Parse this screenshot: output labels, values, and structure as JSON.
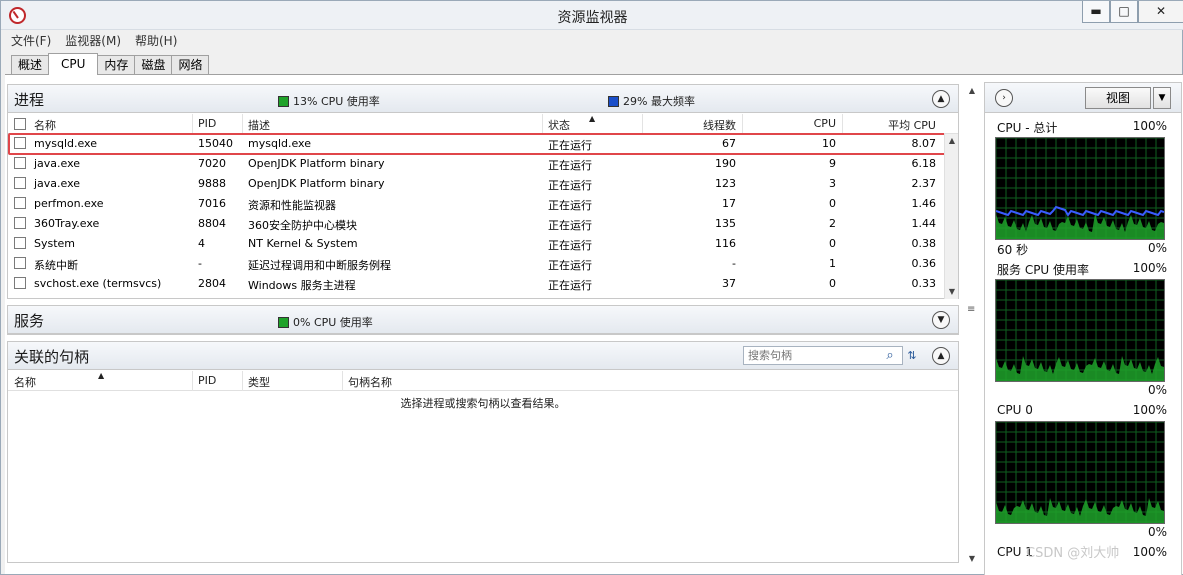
{
  "window": {
    "title": "资源监视器",
    "btn_min": "▬",
    "btn_max": "□",
    "btn_close": "✕"
  },
  "menu": [
    "文件(F)",
    "监视器(M)",
    "帮助(H)"
  ],
  "tabs": [
    "概述",
    "CPU",
    "内存",
    "磁盘",
    "网络"
  ],
  "active_tab": "CPU",
  "process_section": {
    "title": "进程",
    "legend1": "13% CPU 使用率",
    "legend2": "29% 最大频率",
    "legend1_color": "#1fa22a",
    "legend2_color": "#1a4ec9",
    "columns": [
      "名称",
      "PID",
      "描述",
      "状态",
      "线程数",
      "CPU",
      "平均 CPU"
    ],
    "rows": [
      {
        "name": "mysqld.exe",
        "pid": "15040",
        "desc": "mysqld.exe",
        "status": "正在运行",
        "threads": "67",
        "cpu": "10",
        "avg": "8.07",
        "highlight": true
      },
      {
        "name": "java.exe",
        "pid": "7020",
        "desc": "OpenJDK Platform binary",
        "status": "正在运行",
        "threads": "190",
        "cpu": "9",
        "avg": "6.18"
      },
      {
        "name": "java.exe",
        "pid": "9888",
        "desc": "OpenJDK Platform binary",
        "status": "正在运行",
        "threads": "123",
        "cpu": "3",
        "avg": "2.37"
      },
      {
        "name": "perfmon.exe",
        "pid": "7016",
        "desc": "资源和性能监视器",
        "status": "正在运行",
        "threads": "17",
        "cpu": "0",
        "avg": "1.46"
      },
      {
        "name": "360Tray.exe",
        "pid": "8804",
        "desc": "360安全防护中心模块",
        "status": "正在运行",
        "threads": "135",
        "cpu": "2",
        "avg": "1.44"
      },
      {
        "name": "System",
        "pid": "4",
        "desc": "NT Kernel & System",
        "status": "正在运行",
        "threads": "116",
        "cpu": "0",
        "avg": "0.38"
      },
      {
        "name": "系统中断",
        "pid": "-",
        "desc": "延迟过程调用和中断服务例程",
        "status": "正在运行",
        "threads": "-",
        "cpu": "1",
        "avg": "0.36"
      },
      {
        "name": "svchost.exe (termsvcs)",
        "pid": "2804",
        "desc": "Windows 服务主进程",
        "status": "正在运行",
        "threads": "37",
        "cpu": "0",
        "avg": "0.33"
      }
    ]
  },
  "services_section": {
    "title": "服务",
    "legend": "0% CPU 使用率",
    "legend_color": "#1fa22a"
  },
  "handles_section": {
    "title": "关联的句柄",
    "search_placeholder": "搜索句柄",
    "columns": [
      "名称",
      "PID",
      "类型",
      "句柄名称"
    ],
    "empty_message": "选择进程或搜索句柄以查看结果。"
  },
  "right_pane": {
    "view_label": "视图",
    "graphs": [
      {
        "title": "CPU - 总计",
        "max": "100%",
        "footer_left": "60 秒",
        "footer_right": "0%"
      },
      {
        "title": "服务 CPU 使用率",
        "max": "100%",
        "footer_left": "",
        "footer_right": "0%"
      },
      {
        "title": "CPU 0",
        "max": "100%",
        "footer_left": "",
        "footer_right": "0%"
      },
      {
        "title": "CPU 1",
        "max": "100%",
        "footer_left": "",
        "footer_right": ""
      }
    ]
  },
  "watermark": "CSDN @刘大帅"
}
